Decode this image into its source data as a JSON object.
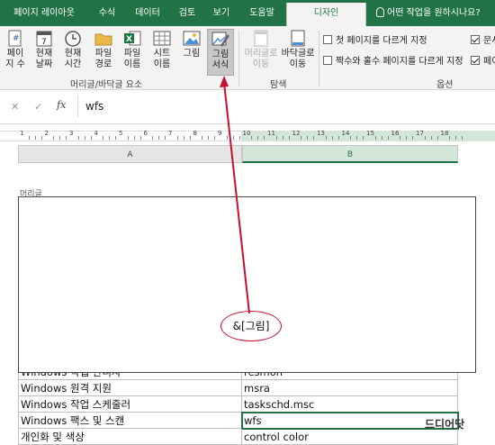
{
  "tabs": [
    {
      "label": "페이지 레이아웃",
      "active": false
    },
    {
      "label": "수식",
      "active": false
    },
    {
      "label": "데이터",
      "active": false
    },
    {
      "label": "검토",
      "active": false
    },
    {
      "label": "보기",
      "active": false
    },
    {
      "label": "도움말",
      "active": false
    },
    {
      "label": "디자인",
      "active": true
    }
  ],
  "tell_me": "어떤 작업을 원하시나요?",
  "ribbon": {
    "buttons": [
      {
        "label": "페이\n지 수",
        "icon": "page-number-icon"
      },
      {
        "label": "현재\n날짜",
        "icon": "calendar-icon"
      },
      {
        "label": "현재\n시간",
        "icon": "clock-icon"
      },
      {
        "label": "파일\n경로",
        "icon": "folder-icon"
      },
      {
        "label": "파일\n이름",
        "icon": "excel-file-icon"
      },
      {
        "label": "시트\n이름",
        "icon": "sheet-icon"
      },
      {
        "label": "그림",
        "icon": "picture-icon"
      },
      {
        "label": "그림\n서식",
        "icon": "format-picture-icon",
        "selected": true
      },
      {
        "label": "머리글로\n이동",
        "icon": "go-to-header-icon",
        "disabled": true
      },
      {
        "label": "바닥글로\n이동",
        "icon": "go-to-footer-icon"
      }
    ],
    "group_header_footer_elements": "머리글/바닥글 요소",
    "group_navigation": "탐색",
    "group_options": "옵션",
    "options": [
      {
        "label": "첫 페이지를 다르게 지정",
        "checked": false
      },
      {
        "label": "문서",
        "checked": true
      },
      {
        "label": "짝수와 홀수 페이지를 다르게 지정",
        "checked": false
      },
      {
        "label": "페이",
        "checked": true
      }
    ]
  },
  "formula_bar": {
    "cancel": "✕",
    "enter": "✓",
    "fx": "fx",
    "value": "wfs"
  },
  "ruler_numbers": [
    "1",
    "2",
    "3",
    "4",
    "5",
    "6",
    "7",
    "8",
    "9",
    "10",
    "11",
    "12",
    "13",
    "14",
    "15",
    "16",
    "17",
    "18"
  ],
  "columns": [
    {
      "label": "A",
      "selected": false
    },
    {
      "label": "B",
      "selected": true
    }
  ],
  "page": {
    "header_label": "머리글",
    "picture_code": "&[그림]"
  },
  "rows": [
    {
      "a": "Windows 작업 관리자",
      "b": "resmon",
      "selected": false
    },
    {
      "a": "Windows 원격 지원",
      "b": "msra",
      "selected": false
    },
    {
      "a": "Windows 작업 스케줄러",
      "b": "taskschd.msc",
      "selected": false
    },
    {
      "a": "Windows 팩스 및 스캔",
      "b": "wfs",
      "selected": true
    },
    {
      "a": "개인화 및 색상",
      "b": "control color",
      "selected": false
    }
  ],
  "watermark": "드디어닷",
  "colors": {
    "accent": "#217346",
    "annotation": "#c8102e"
  }
}
